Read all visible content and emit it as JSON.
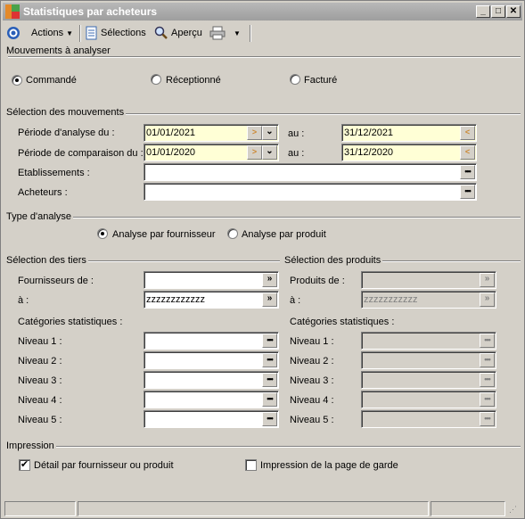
{
  "window": {
    "title": "Statistiques par acheteurs",
    "min": "_",
    "max": "□",
    "close": "✕"
  },
  "toolbar": {
    "actions": "Actions",
    "selections": "Sélections",
    "apercu": "Aperçu"
  },
  "mouvements": {
    "legend": "Mouvements à analyser",
    "options": [
      "Commandé",
      "Réceptionné",
      "Facturé"
    ],
    "selected": "Commandé"
  },
  "selection_mouvements": {
    "legend": "Sélection des mouvements",
    "periode_analyse_label": "Période d'analyse du :",
    "periode_analyse_du": "01/01/2021",
    "periode_analyse_au": "31/12/2021",
    "periode_comparaison_label": "Période de comparaison du :",
    "periode_comparaison_du": "01/01/2020",
    "periode_comparaison_au": "31/12/2020",
    "au_label": "au :",
    "etablissements_label": "Etablissements :",
    "acheteurs_label": "Acheteurs :"
  },
  "type_analyse": {
    "legend": "Type d'analyse",
    "options": [
      "Analyse par fournisseur",
      "Analyse par produit"
    ],
    "selected": "Analyse par fournisseur"
  },
  "tiers": {
    "legend": "Sélection des tiers",
    "fournisseurs_de_label": "Fournisseurs de :",
    "a_label": "à :",
    "a_value": "zzzzzzzzzzzz",
    "categories_label": "Catégories statistiques :",
    "niveaux": [
      "Niveau 1 :",
      "Niveau 2 :",
      "Niveau 3 :",
      "Niveau 4 :",
      "Niveau 5 :"
    ]
  },
  "produits": {
    "legend": "Sélection des produits",
    "produits_de_label": "Produits de :",
    "a_label": "à :",
    "a_value": "zzzzzzzzzzz",
    "categories_label": "Catégories statistiques :",
    "niveaux": [
      "Niveau 1 :",
      "Niveau 2 :",
      "Niveau 3 :",
      "Niveau 4 :",
      "Niveau 5 :"
    ]
  },
  "impression": {
    "legend": "Impression",
    "detail_label": "Détail par fournisseur ou produit",
    "detail_checked": true,
    "page_garde_label": "Impression de la page de garde",
    "page_garde_checked": false
  }
}
